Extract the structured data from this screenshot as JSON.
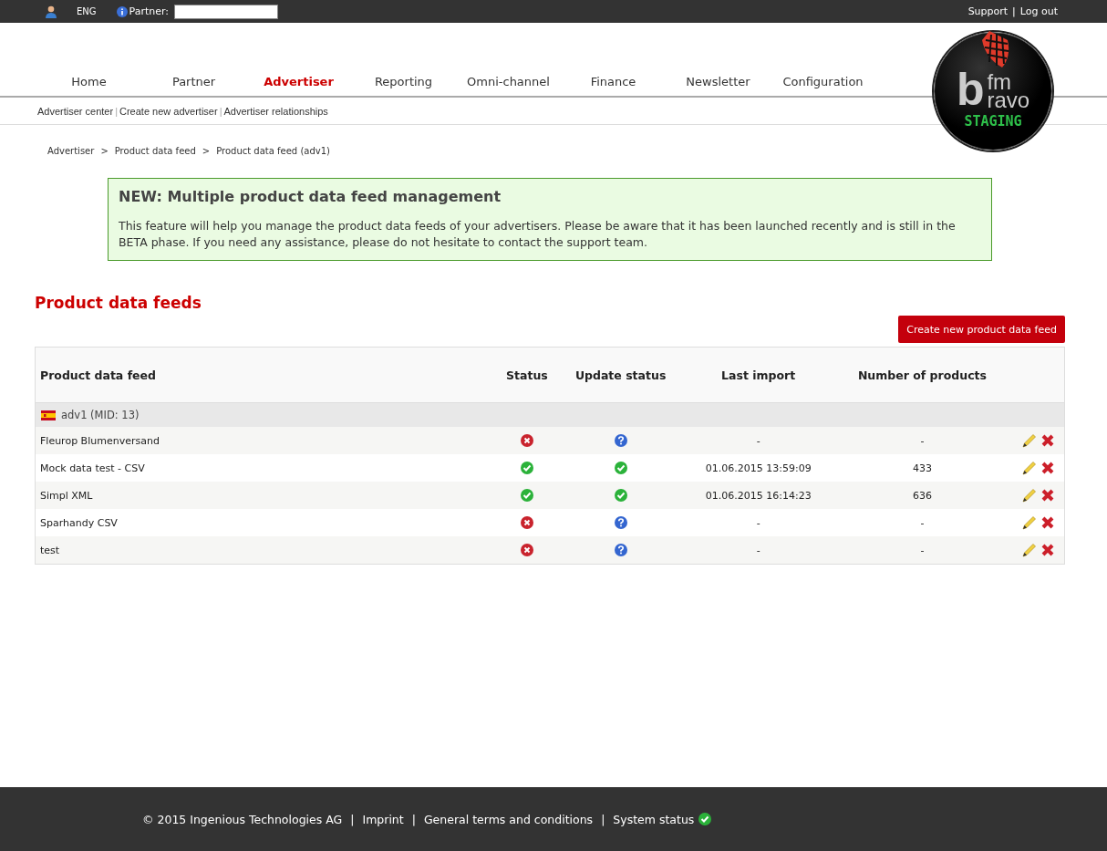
{
  "top_bar": {
    "language": "ENG",
    "partner_label": "Partner:",
    "links": [
      "Support",
      "Log out"
    ],
    "separator": "|"
  },
  "logo": {
    "mark": "b",
    "top": "fm",
    "bottom": "ravo",
    "badge": "STAGING"
  },
  "nav": [
    {
      "label": "Home",
      "selected": false
    },
    {
      "label": "Partner",
      "selected": false
    },
    {
      "label": "Advertiser",
      "selected": true
    },
    {
      "label": "Reporting",
      "selected": false
    },
    {
      "label": "Omni-channel",
      "selected": false
    },
    {
      "label": "Finance",
      "selected": false
    },
    {
      "label": "Newsletter",
      "selected": false
    },
    {
      "label": "Configuration",
      "selected": false
    }
  ],
  "subnav": {
    "links": [
      "Advertiser center",
      "Create new advertiser",
      "Advertiser relationships"
    ],
    "separator": "|"
  },
  "breadcrumb": {
    "links": [
      "Advertiser",
      "Product data feed",
      "Product data feed (adv1)"
    ],
    "separator": ">"
  },
  "notice": {
    "title": "NEW: Multiple product data feed management",
    "text": "This feature will help you manage the product data feeds of your advertisers. Please be aware that it has been launched recently and is still in the BETA phase. If you need any assistance, please do not hesitate to contact the support team."
  },
  "section_title": "Product data feeds",
  "create_button": "Create new product data feed",
  "table": {
    "columns": [
      "Product data feed",
      "Status",
      "Update status",
      "Last import",
      "Number of products"
    ],
    "group": "adv1 (MID: 13)",
    "rows": [
      {
        "name": "Fleurop Blumenversand",
        "status": {
          "kind": "error"
        },
        "update_status": {
          "kind": "unknown"
        },
        "last_import": "-",
        "products": "-"
      },
      {
        "name": "Mock data test - CSV",
        "status": {
          "kind": "ok"
        },
        "update_status": {
          "kind": "ok"
        },
        "last_import": "01.06.2015 13:59:09",
        "products": "433"
      },
      {
        "name": "Simpl XML",
        "status": {
          "kind": "ok"
        },
        "update_status": {
          "kind": "ok"
        },
        "last_import": "01.06.2015 16:14:23",
        "products": "636"
      },
      {
        "name": "Sparhandy CSV",
        "status": {
          "kind": "error"
        },
        "update_status": {
          "kind": "unknown"
        },
        "last_import": "-",
        "products": "-"
      },
      {
        "name": "test",
        "status": {
          "kind": "error"
        },
        "update_status": {
          "kind": "unknown"
        },
        "last_import": "-",
        "products": "-"
      }
    ]
  },
  "footer": {
    "copyright": "© 2015 Ingenious Technologies AG",
    "links": [
      "Imprint",
      "General terms and conditions",
      "System status"
    ],
    "separator": "|",
    "system_status": {
      "kind": "ok"
    }
  }
}
